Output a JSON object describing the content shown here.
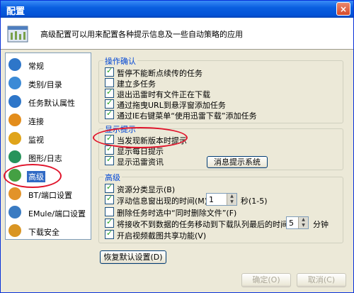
{
  "window": {
    "title": "配置",
    "close": "×"
  },
  "banner": {
    "text": "高级配置可以用来配置各种提示信息及一些自动策略的应用"
  },
  "nav": [
    {
      "label": "常规",
      "color": "#2e76c9",
      "selected": false
    },
    {
      "label": "类别/目录",
      "color": "#3b8ad6",
      "selected": false
    },
    {
      "label": "任务默认属性",
      "color": "#2e76c9",
      "selected": false
    },
    {
      "label": "连接",
      "color": "#e38d1b",
      "selected": false
    },
    {
      "label": "监视",
      "color": "#e0a41a",
      "selected": false
    },
    {
      "label": "图形/日志",
      "color": "#27935b",
      "selected": false
    },
    {
      "label": "高级",
      "color": "#44a043",
      "selected": true
    },
    {
      "label": "BT/端口设置",
      "color": "#e2932a",
      "selected": false
    },
    {
      "label": "EMule/端口设置",
      "color": "#3a7bc2",
      "selected": false
    },
    {
      "label": "下载安全",
      "color": "#d99523",
      "selected": false
    }
  ],
  "ops": {
    "title": "操作确认",
    "items": [
      {
        "label": "暂停不能断点续传的任务",
        "checked": true
      },
      {
        "label": "建立多任务",
        "checked": false
      },
      {
        "label": "退出迅雷时有文件正在下载",
        "checked": true
      },
      {
        "label": "通过拖曳URL到悬浮窗添加任务",
        "checked": true
      },
      {
        "label": "通过IE右键菜单“使用迅雷下载”添加任务",
        "checked": true
      }
    ]
  },
  "tips": {
    "title": "显示提示",
    "items": [
      {
        "label": "当发现新版本时提示",
        "checked": true
      },
      {
        "label": "显示每日提示",
        "checked": true
      },
      {
        "label": "显示迅雷资讯",
        "checked": true
      }
    ],
    "msg_button": "消息提示系统"
  },
  "advanced": {
    "title": "高级",
    "items": [
      {
        "label": "资源分类显示(B)",
        "checked": true
      },
      {
        "label": "浮动信息窗出现的时间(M)",
        "checked": true
      },
      {
        "label": "删除任务时选中“同时删除文件”(F)",
        "checked": false
      },
      {
        "label": "将接收不到数据的任务移动到下载队列最后的时间(I)",
        "checked": true
      },
      {
        "label": "开启视频截图共享功能(V)",
        "checked": true
      }
    ],
    "float_value": "1",
    "float_unit": "秒(1-5)",
    "move_value": "5",
    "move_unit": "分钟"
  },
  "restore_button": "恢复默认设置(D)",
  "footer": {
    "ok": "确定(O)",
    "cancel": "取消(C)"
  }
}
